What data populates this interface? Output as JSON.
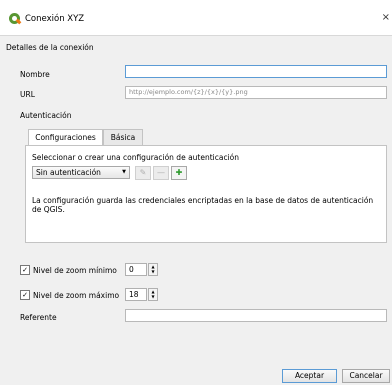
{
  "window": {
    "title": "Conexión XYZ",
    "close_glyph": "×"
  },
  "connection": {
    "group_title": "Detalles de la conexión",
    "name_label": "Nombre",
    "name_value": "",
    "url_label": "URL",
    "url_placeholder": "http://ejemplo.com/{z}/{x}/{y}.png",
    "auth_label": "Autenticación"
  },
  "auth": {
    "tabs": [
      {
        "label": "Configuraciones",
        "active": true
      },
      {
        "label": "Básica",
        "active": false
      }
    ],
    "select_prompt": "Seleccionar o crear una configuración de autenticación",
    "config_value": "Sin autenticación",
    "edit_icon": "pencil-icon",
    "remove_icon": "minus-icon",
    "add_icon": "plus-icon",
    "info_text": "La configuración guarda las credenciales encriptadas en la base de datos de autenticación de QGIS."
  },
  "zoom": {
    "min_label": "Nivel de zoom mínimo",
    "min_checked": true,
    "min_value": "0",
    "max_label": "Nivel de zoom máximo",
    "max_checked": true,
    "max_value": "18"
  },
  "referer": {
    "label": "Referente",
    "value": ""
  },
  "buttons": {
    "accept": "Aceptar",
    "cancel": "Cancelar"
  },
  "colors": {
    "focus": "#5b9bd5",
    "logo_green": "#589632",
    "logo_orange": "#ee7913"
  }
}
